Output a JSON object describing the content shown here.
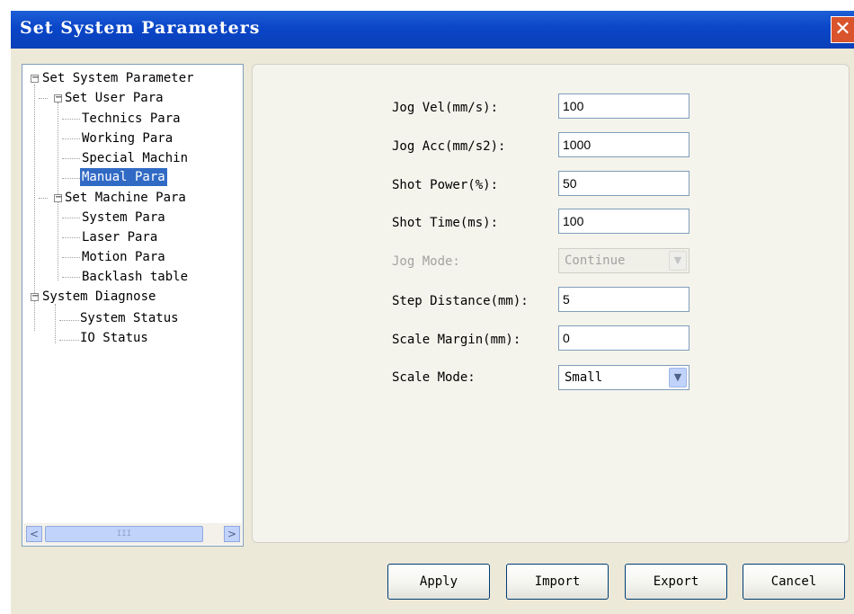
{
  "window": {
    "title": "Set System Parameters",
    "close_glyph": "✕"
  },
  "tree": {
    "root": {
      "label": "Set System Parameter",
      "expander": "−"
    },
    "user": {
      "label": "Set User Para",
      "expander": "−",
      "items": [
        "Technics Para",
        "Working Para",
        "Special Machin",
        "Manual Para"
      ]
    },
    "machine": {
      "label": "Set Machine Para",
      "expander": "−",
      "items": [
        "System Para",
        "Laser Para",
        "Motion Para",
        "Backlash table"
      ]
    },
    "diag": {
      "label": "System Diagnose",
      "expander": "−",
      "items": [
        "System Status",
        "IO Status"
      ]
    },
    "selected": "Manual Para"
  },
  "scrollbar": {
    "left": "<",
    "right": ">",
    "grip": "III"
  },
  "form": {
    "jog_vel": {
      "label": "Jog Vel(mm/s):",
      "value": "100"
    },
    "jog_acc": {
      "label": "Jog Acc(mm/s2):",
      "value": "1000"
    },
    "shot_power": {
      "label": "Shot Power(%):",
      "value": "50"
    },
    "shot_time": {
      "label": "Shot Time(ms):",
      "value": "100"
    },
    "jog_mode": {
      "label": "Jog Mode:",
      "value": "Continue",
      "disabled": true
    },
    "step_distance": {
      "label": "Step Distance(mm):",
      "value": "5"
    },
    "scale_margin": {
      "label": "Scale Margin(mm):",
      "value": "0"
    },
    "scale_mode": {
      "label": "Scale Mode:",
      "value": "Small"
    },
    "dropdown_glyph": "▼"
  },
  "buttons": {
    "apply": "Apply",
    "import": "Import",
    "export": "Export",
    "cancel": "Cancel"
  },
  "colors": {
    "title_bar": "#0a46c8",
    "selection": "#316ac5",
    "dialog_bg": "#ece9d8"
  }
}
